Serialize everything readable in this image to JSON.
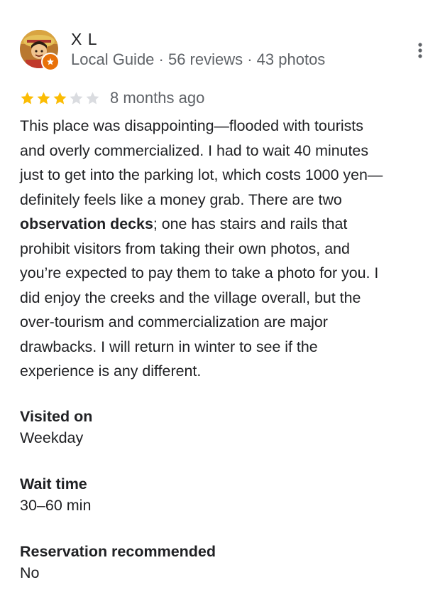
{
  "reviewer": {
    "name": "X L",
    "meta": "Local Guide · 56 reviews · 43 photos"
  },
  "review": {
    "rating": 3,
    "max_rating": 5,
    "date": "8 months ago",
    "lines": [
      [
        "This place was disappointing—flooded with tourists"
      ],
      [
        "and overly commercialized. I had to wait 40 minutes"
      ],
      [
        "just to get into the parking lot, which costs 1000 yen—"
      ],
      [
        "definitely feels like a money grab. There are two"
      ],
      [
        "",
        "observation decks",
        "; one has stairs and rails that"
      ],
      [
        "prohibit visitors from taking their own photos, and"
      ],
      [
        "you’re expected to pay them to take a photo for you. I"
      ],
      [
        "did enjoy the creeks and the village overall, but the"
      ],
      [
        "over-tourism and commercialization are major"
      ],
      [
        "drawbacks. I will return in winter to see if the"
      ],
      [
        "experience is any different."
      ]
    ]
  },
  "details": [
    {
      "label": "Visited on",
      "value": "Weekday"
    },
    {
      "label": "Wait time",
      "value": "30–60 min"
    },
    {
      "label": "Reservation recommended",
      "value": "No"
    }
  ],
  "colors": {
    "star_filled": "#fbbc04",
    "star_empty": "#dadce0",
    "badge": "#e8710a",
    "secondary_text": "#5f6368"
  },
  "icons": {
    "avatar": "avatar-photo",
    "badge": "local-guide-badge-icon",
    "more": "more-vert-icon",
    "star": "star-icon"
  }
}
